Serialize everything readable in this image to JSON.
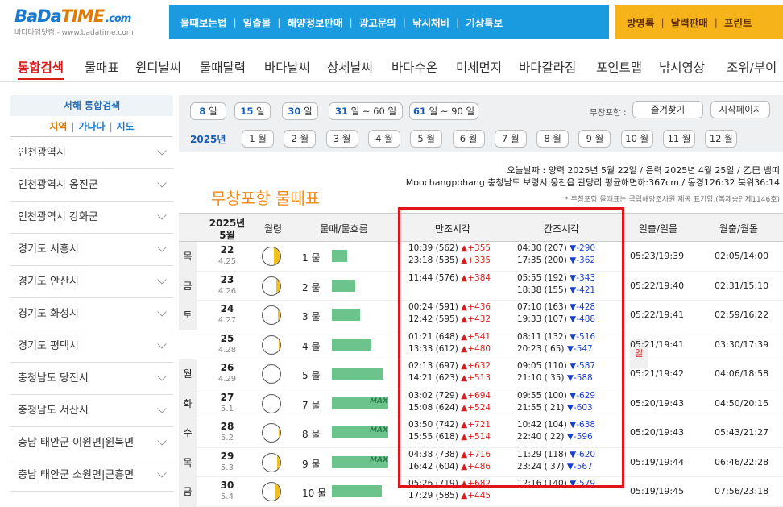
{
  "logo": {
    "part1": "BaDa",
    "part2": "TIME",
    "suffix": ".com",
    "sub": "바다타임닷컴 - www.badatime.com"
  },
  "topnav": [
    "물때보는법",
    "일출몰",
    "해양정보판매",
    "광고문의",
    "낚시채비",
    "기상특보"
  ],
  "topright": [
    "방명록",
    "달력판매",
    "프린트"
  ],
  "menu": [
    "통합검색",
    "물때표",
    "윈디날씨",
    "물때달력",
    "바다날씨",
    "상세날씨",
    "바다수온",
    "미세먼지",
    "바다갈라짐",
    "포인트맵",
    "낚시영상",
    "조위/부이"
  ],
  "sidebar": {
    "head": "서해 통합검색",
    "tabs": [
      "지역",
      "가나다",
      "지도"
    ],
    "items": [
      "인천광역시",
      "인천광역시 옹진군",
      "인천광역시 강화군",
      "경기도 시흥시",
      "경기도 안산시",
      "경기도 화성시",
      "경기도 평택시",
      "충청남도 당진시",
      "충청남도 서산시",
      "충남 태안군 이원면|원북면",
      "충남 태안군 소원면|근흥면"
    ]
  },
  "ranges": [
    {
      "a": "8",
      "b": " 일"
    },
    {
      "a": "15",
      "b": " 일"
    },
    {
      "a": "30",
      "b": " 일"
    },
    {
      "a": "31",
      "b": " 일 ~ 60 일"
    },
    {
      "a": "61",
      "b": " 일 ~ 90 일"
    }
  ],
  "rangebar": {
    "label": "무창포항 :",
    "fav": "즐겨찾기",
    "home": "시작페이지",
    "year": "2025년"
  },
  "months": [
    "1 월",
    "2 월",
    "3 월",
    "4 월",
    "5 월",
    "6 월",
    "7 월",
    "8 월",
    "9 월",
    "10 월",
    "11 월",
    "12 월"
  ],
  "info": {
    "line1": "오늘날짜 : 양력 2025년 5월 22일 / 음력 2025년 4월 25일 / 乙巳 뱀띠",
    "line2": "Moochangpohang 충청남도 보령시 웅천읍 관당리 평균해면하:367cm / 동경126:32 북위36:14",
    "line3": "* 무창포항 물때표는 국립해양조사원 제공 표기함.(복제승인제1146호)"
  },
  "page_title": "무창포항 물때표",
  "table": {
    "headers": {
      "date1": "2025년",
      "date2": "5월",
      "moon": "월령",
      "flow": "물때/물흐름",
      "high": "만조시각",
      "low": "간조시각",
      "sun": "일출/일몰",
      "moonrise": "월출/월몰"
    },
    "rows": [
      {
        "dow": "목",
        "day": "22",
        "lunar": "4.25",
        "mul": "1 물",
        "bar": 0.27,
        "max": "",
        "phase": 0.35,
        "h1": "10:39 (562) ",
        "h1d": "▲+355",
        "h2": "23:18 (535) ",
        "h2d": "▲+335",
        "l1": "04:30 (207) ",
        "l1d": "▼-290",
        "l2": "17:35 (200) ",
        "l2d": "▼-362",
        "sun": "05:23/19:39",
        "moon": "02:05/14:00"
      },
      {
        "dow": "금",
        "day": "23",
        "lunar": "4.26",
        "mul": "2 물",
        "bar": 0.42,
        "max": "",
        "phase": 0.25,
        "h1": "11:44 (576) ",
        "h1d": "▲+384",
        "h2": "",
        "h2d": "",
        "l1": "05:55 (192) ",
        "l1d": "▼-343",
        "l2": "18:38 (155) ",
        "l2d": "▼-421",
        "sun": "05:22/19:40",
        "moon": "02:31/15:10"
      },
      {
        "dow": "토",
        "day": "24",
        "lunar": "4.27",
        "mul": "3 물",
        "bar": 0.5,
        "max": "",
        "phase": 0.15,
        "h1": "00:24 (591) ",
        "h1d": "▲+436",
        "h2": "12:42 (595) ",
        "h2d": "▲+432",
        "l1": "07:10 (163) ",
        "l1d": "▼-428",
        "l2": "19:33 (107) ",
        "l2d": "▼-488",
        "sun": "05:22/19:41",
        "moon": "02:59/16:22"
      },
      {
        "dow": "일",
        "day": "25",
        "lunar": "4.28",
        "mul": "4 물",
        "bar": 0.7,
        "max": "",
        "phase": 0.08,
        "h1": "01:21 (648) ",
        "h1d": "▲+541",
        "h2": "13:33 (612) ",
        "h2d": "▲+480",
        "l1": "08:11 (132) ",
        "l1d": "▼-516",
        "l2": "20:23 ( 65) ",
        "l2d": "▼-547",
        "sun": "05:21/19:41",
        "moon": "03:30/17:39"
      },
      {
        "dow": "월",
        "day": "26",
        "lunar": "4.29",
        "mul": "5 물",
        "bar": 0.92,
        "max": "",
        "phase": 0.03,
        "h1": "02:13 (697) ",
        "h1d": "▲+632",
        "h2": "14:21 (623) ",
        "h2d": "▲+513",
        "l1": "09:05 (110) ",
        "l1d": "▼-587",
        "l2": "21:10 ( 35) ",
        "l2d": "▼-588",
        "sun": "05:21/19:42",
        "moon": "04:06/18:58"
      },
      {
        "dow": "화",
        "day": "27",
        "lunar": "5.1",
        "mul": "7 물",
        "bar": 1.0,
        "max": "MAX",
        "phase": 0.04,
        "h1": "03:02 (729) ",
        "h1d": "▲+694",
        "h2": "15:08 (624) ",
        "h2d": "▲+524",
        "l1": "09:55 (100) ",
        "l1d": "▼-629",
        "l2": "21:55 ( 21) ",
        "l2d": "▼-603",
        "sun": "05:20/19:43",
        "moon": "04:50/20:15"
      },
      {
        "dow": "수",
        "day": "28",
        "lunar": "5.2",
        "mul": "8 물",
        "bar": 1.0,
        "max": "MAX",
        "phase": 0.1,
        "h1": "03:50 (742) ",
        "h1d": "▲+721",
        "h2": "15:55 (618) ",
        "h2d": "▲+514",
        "l1": "10:42 (104) ",
        "l1d": "▼-638",
        "l2": "22:40 ( 22) ",
        "l2d": "▼-596",
        "sun": "05:20/19:43",
        "moon": "05:43/21:27"
      },
      {
        "dow": "목",
        "day": "29",
        "lunar": "5.3",
        "mul": "9 물",
        "bar": 1.0,
        "max": "MAX",
        "phase": 0.18,
        "h1": "04:38 (738) ",
        "h1d": "▲+716",
        "h2": "16:42 (604) ",
        "h2d": "▲+486",
        "l1": "11:29 (118) ",
        "l1d": "▼-620",
        "l2": "23:24 ( 37) ",
        "l2d": "▼-567",
        "sun": "05:19/19:44",
        "moon": "06:46/22:28"
      },
      {
        "dow": "금",
        "day": "30",
        "lunar": "5.4",
        "mul": "10 물",
        "bar": 0.88,
        "max": "",
        "phase": 0.27,
        "h1": "05:26 (719) ",
        "h1d": "▲+682",
        "h2": "17:29 (585) ",
        "h2d": "▲+445",
        "l1": "12:16 (140) ",
        "l1d": "▼-579",
        "l2": "",
        "l2d": "",
        "sun": "05:19/19:45",
        "moon": "07:56/23:18"
      }
    ]
  }
}
